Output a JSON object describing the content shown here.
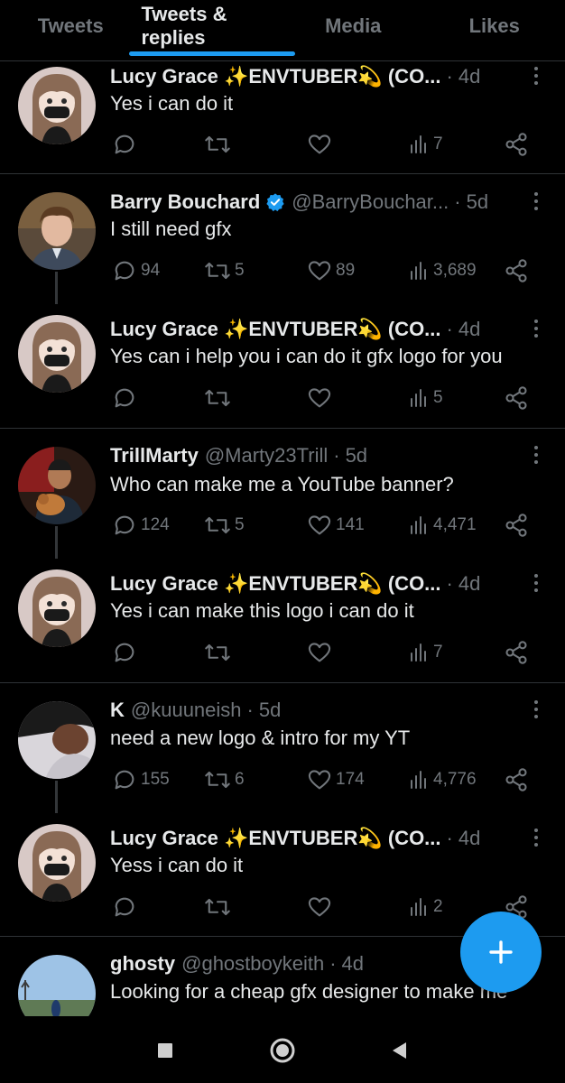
{
  "tabs": [
    "Tweets",
    "Tweets & replies",
    "Media",
    "Likes"
  ],
  "tweets": [
    {
      "name": "Lucy Grace ✨ENVTUBER💫 (CO...",
      "handle": "",
      "time": "4d",
      "text": "Yes i can do it",
      "replies": "",
      "retweets": "",
      "likes": "",
      "views": "7",
      "avatar": "anime-girl"
    },
    {
      "name": "Barry Bouchard",
      "handle": "@BarryBouchar...",
      "time": "5d",
      "text": "I still need gfx",
      "replies": "94",
      "retweets": "5",
      "likes": "89",
      "views": "3,689",
      "avatar": "person"
    },
    {
      "name": "Lucy Grace ✨ENVTUBER💫 (CO...",
      "handle": "",
      "time": "4d",
      "text": "Yes can i help you i can do it gfx logo for you",
      "replies": "",
      "retweets": "",
      "likes": "",
      "views": "5",
      "avatar": "anime-girl"
    },
    {
      "name": "TrillMarty",
      "handle": "@Marty23Trill",
      "time": "5d",
      "text": "Who can make me a YouTube banner?",
      "replies": "124",
      "retweets": "5",
      "likes": "141",
      "views": "4,471",
      "avatar": "person"
    },
    {
      "name": "Lucy Grace ✨ENVTUBER💫 (CO...",
      "handle": "",
      "time": "4d",
      "text": "Yes i can make this logo i can do it",
      "replies": "",
      "retweets": "",
      "likes": "",
      "views": "7",
      "avatar": "anime-girl"
    },
    {
      "name": "K",
      "handle": "@kuuuneish",
      "time": "5d",
      "text": "need a new logo & intro for my YT",
      "replies": "155",
      "retweets": "6",
      "likes": "174",
      "views": "4,776",
      "avatar": "person"
    },
    {
      "name": "Lucy Grace ✨ENVTUBER💫 (CO...",
      "handle": "",
      "time": "4d",
      "text": "Yess i can do it",
      "replies": "",
      "retweets": "",
      "likes": "",
      "views": "2",
      "avatar": "anime-girl"
    },
    {
      "name": "ghosty",
      "handle": "@ghostboykeith",
      "time": "4d",
      "text": "Looking for a cheap gfx designer to make me",
      "replies": "",
      "retweets": "",
      "likes": "",
      "views": "",
      "avatar": "landscape"
    }
  ],
  "fab_icon": "compose-plus-icon",
  "navbar": [
    "recents-square-icon",
    "home-circle-icon",
    "back-triangle-icon"
  ],
  "colors": {
    "accent": "#1d9bf0",
    "muted": "#71767b",
    "background": "#000000",
    "text": "#e7e9ea"
  }
}
